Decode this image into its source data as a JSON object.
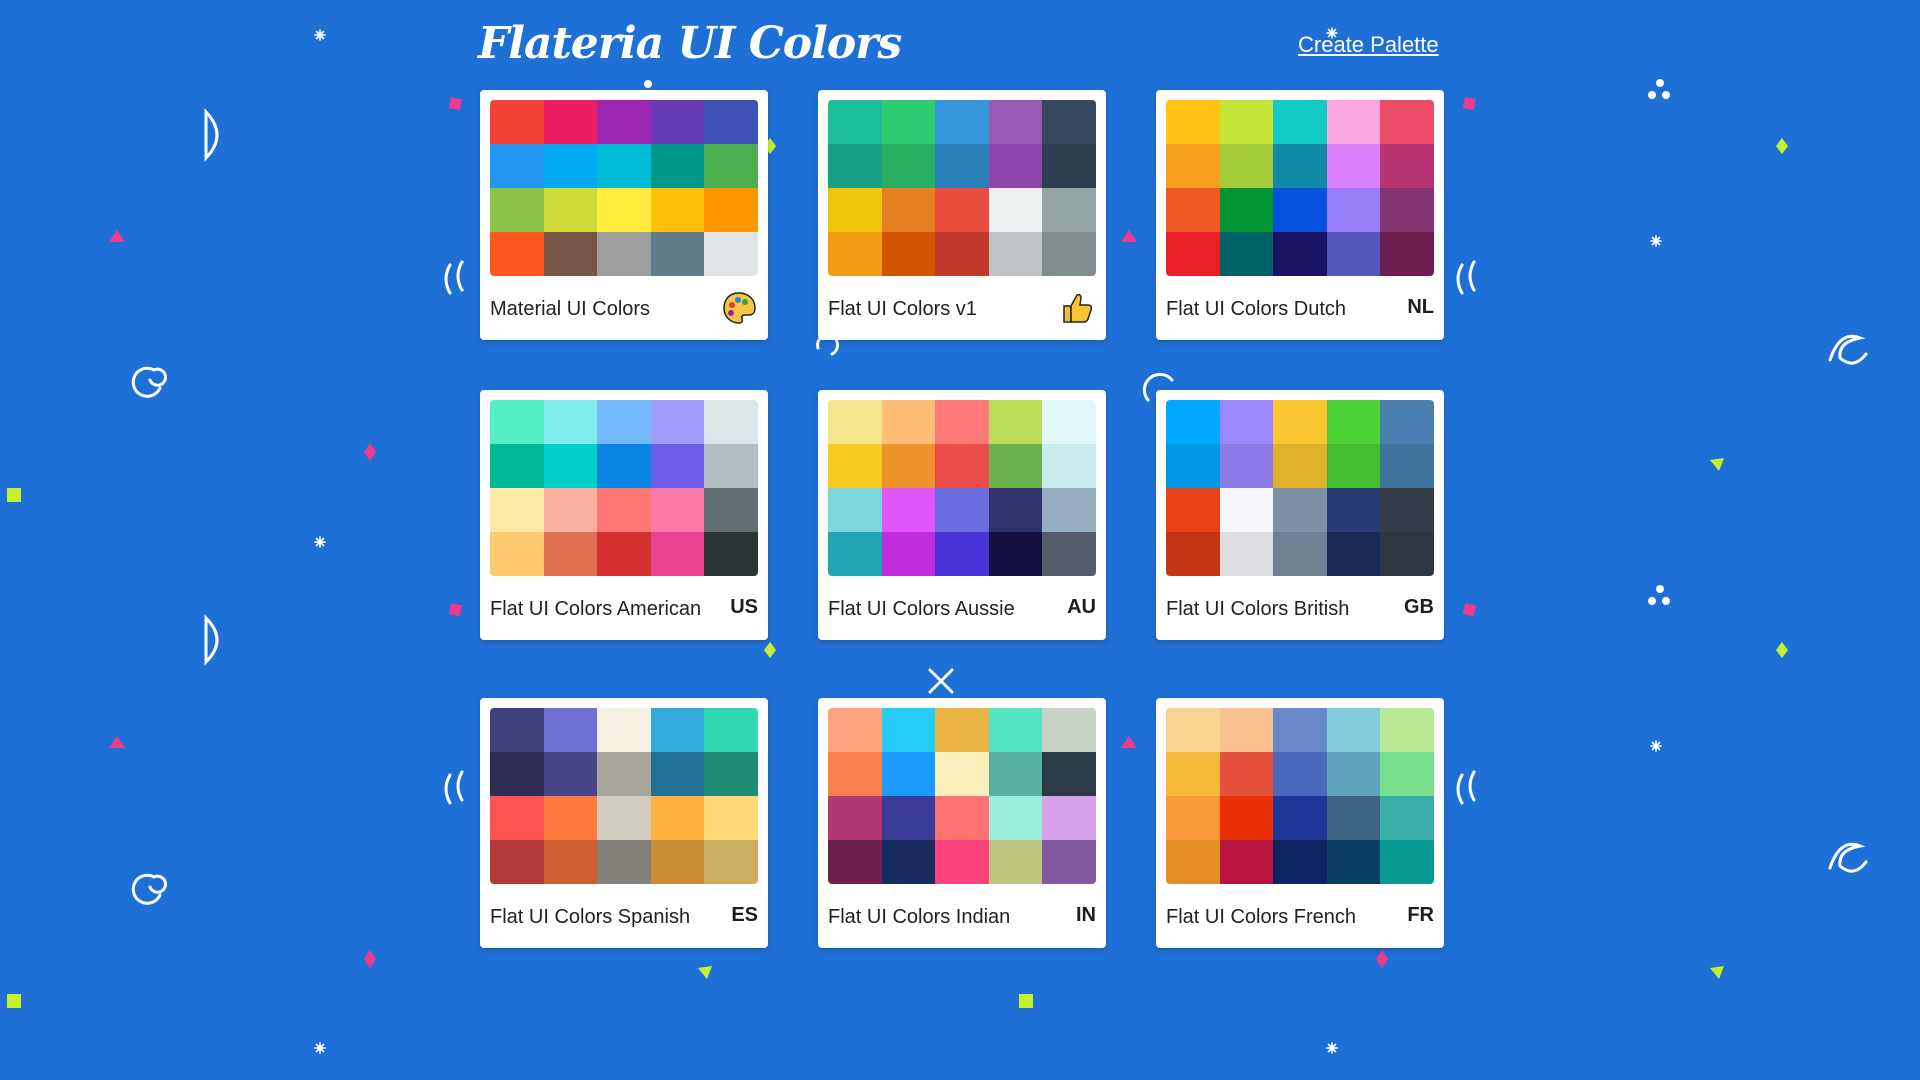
{
  "header": {
    "title": "Flateria UI Colors",
    "create_label": "Create Palette"
  },
  "palettes": [
    {
      "name": "Material UI Colors",
      "code": "",
      "icon": "palette-icon",
      "colors": [
        "#f44336",
        "#e91e63",
        "#9c27b0",
        "#673ab7",
        "#3f51b5",
        "#2196f3",
        "#03a9f4",
        "#00bcd4",
        "#009688",
        "#4caf50",
        "#8bc34a",
        "#cddc39",
        "#ffeb3b",
        "#ffc107",
        "#ff9800",
        "#ff5722",
        "#795548",
        "#9e9e9e",
        "#607d8b",
        "#dfe4e6"
      ]
    },
    {
      "name": "Flat UI Colors v1",
      "code": "",
      "icon": "thumbs-up-icon",
      "colors": [
        "#1abc9c",
        "#2ecc71",
        "#3498db",
        "#9b59b6",
        "#34495e",
        "#16a085",
        "#27ae60",
        "#2980b9",
        "#8e44ad",
        "#2c3e50",
        "#f1c40f",
        "#e67e22",
        "#e74c3c",
        "#ecf0f1",
        "#95a5a6",
        "#f39c12",
        "#d35400",
        "#c0392b",
        "#bdc3c7",
        "#7f8c8d"
      ]
    },
    {
      "name": "Flat UI Colors Dutch",
      "code": "NL",
      "icon": "",
      "colors": [
        "#ffc312",
        "#c4e538",
        "#12cbc4",
        "#fda7df",
        "#ed4c67",
        "#f79f1f",
        "#a3cb38",
        "#1289a7",
        "#d980fa",
        "#b53471",
        "#ee5a24",
        "#009432",
        "#0652dd",
        "#9980fa",
        "#833471",
        "#ea2027",
        "#006266",
        "#1b1464",
        "#5758bb",
        "#6f1e51"
      ]
    },
    {
      "name": "Flat UI Colors American",
      "code": "US",
      "icon": "",
      "colors": [
        "#55efc4",
        "#81ecec",
        "#74b9ff",
        "#a29bfe",
        "#dfe6e9",
        "#00b894",
        "#00cec9",
        "#0984e3",
        "#6c5ce7",
        "#b2bec3",
        "#ffeaa7",
        "#fab1a0",
        "#ff7675",
        "#fd79a8",
        "#636e72",
        "#fdcb6e",
        "#e17055",
        "#d63031",
        "#e84393",
        "#2d3436"
      ]
    },
    {
      "name": "Flat UI Colors Aussie",
      "code": "AU",
      "icon": "",
      "colors": [
        "#f6e58d",
        "#ffbe76",
        "#ff7979",
        "#badc58",
        "#dff9fb",
        "#f9ca24",
        "#f0932b",
        "#eb4d4b",
        "#6ab04c",
        "#c7ecee",
        "#7ed6df",
        "#e056fd",
        "#686de0",
        "#30336b",
        "#95afc0",
        "#22a6b3",
        "#be2edd",
        "#4834d4",
        "#130f40",
        "#535c68"
      ]
    },
    {
      "name": "Flat UI Colors British",
      "code": "GB",
      "icon": "",
      "colors": [
        "#00a8ff",
        "#9c88ff",
        "#fbc531",
        "#4cd137",
        "#487eb0",
        "#0097e6",
        "#8c7ae6",
        "#e1b12c",
        "#44bd32",
        "#40739e",
        "#e84118",
        "#f5f6fa",
        "#7f8fa6",
        "#273c75",
        "#353b48",
        "#c23616",
        "#dcdde1",
        "#718093",
        "#192a56",
        "#2f3640"
      ]
    },
    {
      "name": "Flat UI Colors Spanish",
      "code": "ES",
      "icon": "",
      "colors": [
        "#40407a",
        "#706fd3",
        "#f7f1e3",
        "#34ace0",
        "#33d9b2",
        "#2c2c54",
        "#474787",
        "#aaa69d",
        "#227093",
        "#218c74",
        "#ff5252",
        "#ff793f",
        "#d1ccc0",
        "#ffb142",
        "#ffda79",
        "#b33939",
        "#cd6133",
        "#84817a",
        "#cc8e35",
        "#ccae62"
      ]
    },
    {
      "name": "Flat UI Colors Indian",
      "code": "IN",
      "icon": "",
      "colors": [
        "#fea47f",
        "#25ccf7",
        "#eab543",
        "#55e6c1",
        "#cad3c8",
        "#f97f51",
        "#1b9cfc",
        "#f8efba",
        "#58b19f",
        "#2c3a47",
        "#b33771",
        "#3b3b98",
        "#fd7272",
        "#9aecdb",
        "#d6a2e8",
        "#6d214f",
        "#182c61",
        "#fc427b",
        "#bdc581",
        "#82589f"
      ]
    },
    {
      "name": "Flat UI Colors French",
      "code": "FR",
      "icon": "",
      "colors": [
        "#fad390",
        "#f8c291",
        "#6a89cc",
        "#82ccdd",
        "#b8e994",
        "#f6b93b",
        "#e55039",
        "#4a69bd",
        "#60a3bc",
        "#78e08f",
        "#fa983a",
        "#eb2f06",
        "#1e3799",
        "#3c6382",
        "#38ada9",
        "#e58e26",
        "#b71540",
        "#0c2461",
        "#0a3d62",
        "#079992"
      ]
    }
  ]
}
